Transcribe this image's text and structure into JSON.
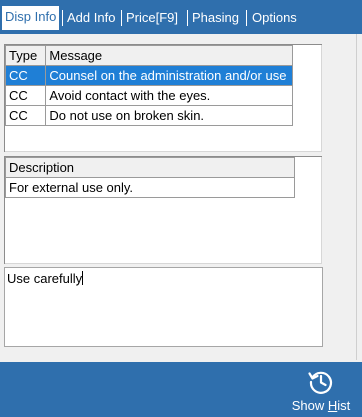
{
  "tabs": [
    {
      "label": "Disp Info",
      "active": true
    },
    {
      "label": "Add Info",
      "active": false
    },
    {
      "label": "Price[F9]",
      "active": false
    },
    {
      "label": "Phasing",
      "active": false
    },
    {
      "label": "Options",
      "active": false
    }
  ],
  "messages_grid": {
    "columns": [
      "Type",
      "Message"
    ],
    "rows": [
      {
        "type": "CC",
        "message": "Counsel on the administration and/or use",
        "selected": true
      },
      {
        "type": "CC",
        "message": "Avoid contact with the eyes.",
        "selected": false
      },
      {
        "type": "CC",
        "message": "Do not use on broken skin.",
        "selected": false
      }
    ]
  },
  "description_grid": {
    "column": "Description",
    "rows": [
      "For external use only."
    ]
  },
  "notes": {
    "value": "Use carefully"
  },
  "bottom_bar": {
    "show_hist_label_pre": "Show ",
    "show_hist_label_key": "H",
    "show_hist_label_post": "ist",
    "icon": "history-icon"
  },
  "colors": {
    "accent": "#2f6fad",
    "selection": "#1f7fd6"
  }
}
